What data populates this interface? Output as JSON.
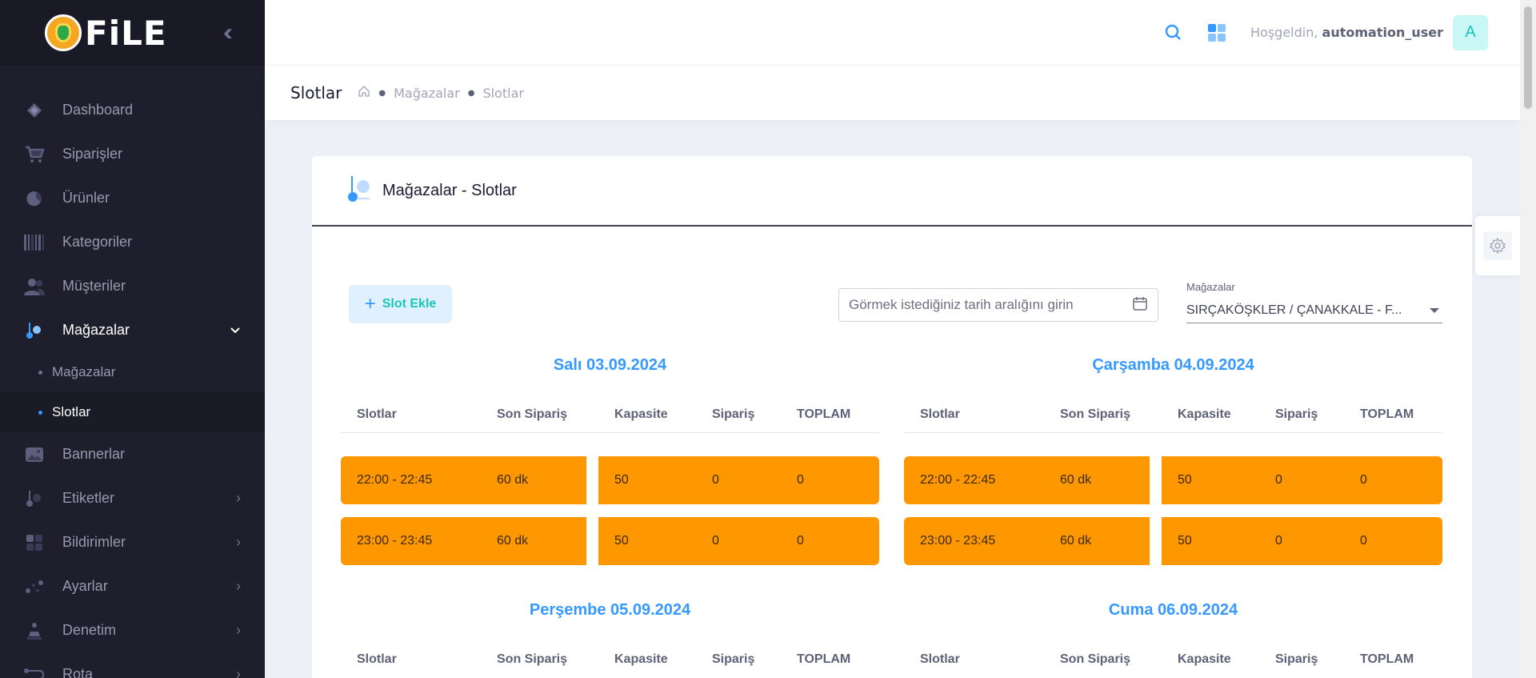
{
  "brand": {
    "name": "FiLE"
  },
  "sidebar": {
    "items": [
      {
        "label": "Dashboard",
        "icon": "diamond-icon"
      },
      {
        "label": "Siparişler",
        "icon": "cart-icon"
      },
      {
        "label": "Ürünler",
        "icon": "moon-icon"
      },
      {
        "label": "Kategoriler",
        "icon": "barcode-icon"
      },
      {
        "label": "Müşteriler",
        "icon": "users-icon"
      },
      {
        "label": "Mağazalar",
        "icon": "store-icon"
      },
      {
        "label": "Bannerlar",
        "icon": "image-icon"
      },
      {
        "label": "Etiketler",
        "icon": "tag-icon"
      },
      {
        "label": "Bildirimler",
        "icon": "grid-icon"
      },
      {
        "label": "Ayarlar",
        "icon": "settings-icon"
      },
      {
        "label": "Denetim",
        "icon": "audit-icon"
      },
      {
        "label": "Rota",
        "icon": "route-icon"
      }
    ],
    "sub_items": [
      {
        "label": "Mağazalar"
      },
      {
        "label": "Slotlar"
      }
    ]
  },
  "header": {
    "greeting": "Hoşgeldin,",
    "username": "automation_user",
    "avatar_letter": "A"
  },
  "subheader": {
    "title": "Slotlar",
    "breadcrumb": [
      "Mağazalar",
      "Slotlar"
    ]
  },
  "card": {
    "title": "Mağazalar - Slotlar",
    "add_button": "Slot Ekle",
    "date_placeholder": "Görmek istediğiniz tarih aralığını girin",
    "store_label": "Mağazalar",
    "store_value": "SIRÇAKÖŞKLER / ÇANAKKALE - F..."
  },
  "table_headers": [
    "Slotlar",
    "Son Sipariş",
    "Kapasite",
    "Sipariş",
    "TOPLAM"
  ],
  "days": [
    {
      "title": "Salı 03.09.2024",
      "rows": [
        {
          "slot": "22:00 - 22:45",
          "son": "60 dk",
          "kapasite": "50",
          "siparis": "0",
          "toplam": "0"
        },
        {
          "slot": "23:00 - 23:45",
          "son": "60 dk",
          "kapasite": "50",
          "siparis": "0",
          "toplam": "0"
        }
      ]
    },
    {
      "title": "Çarşamba 04.09.2024",
      "rows": [
        {
          "slot": "22:00 - 22:45",
          "son": "60 dk",
          "kapasite": "50",
          "siparis": "0",
          "toplam": "0"
        },
        {
          "slot": "23:00 - 23:45",
          "son": "60 dk",
          "kapasite": "50",
          "siparis": "0",
          "toplam": "0"
        }
      ]
    },
    {
      "title": "Perşembe 05.09.2024",
      "rows": []
    },
    {
      "title": "Cuma 06.09.2024",
      "rows": []
    }
  ],
  "colors": {
    "sidebar": "#1e1e2d",
    "accent": "#3699ff",
    "slot": "#ff9800"
  }
}
